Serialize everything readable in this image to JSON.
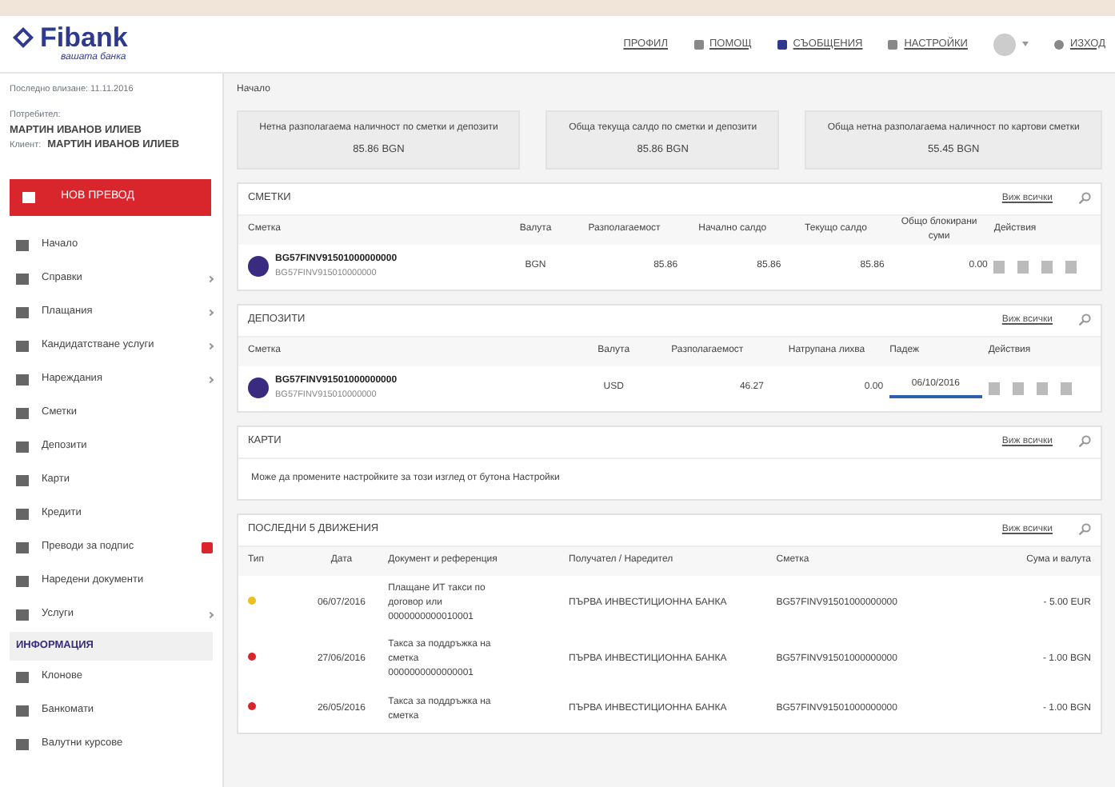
{
  "header": {
    "logo": "Fibank",
    "tagline": "вашата банка",
    "nav": [
      {
        "label": "ПРОФИЛ"
      },
      {
        "label": "ПОМОЩ"
      },
      {
        "label": "СЪОБЩЕНИЯ"
      },
      {
        "label": "НАСТРОЙКИ"
      },
      {
        "label": "ИЗХОД"
      }
    ]
  },
  "user": {
    "last_login": "Последно влизане: 11.11.2016",
    "user_label": "Потребител:",
    "user_name": "МАРТИН ИВАНОВ ИЛИЕВ",
    "client_label": "Клиент:",
    "client_name": "МАРТИН ИВАНОВ ИЛИЕВ"
  },
  "new_transfer": "НОВ ПРЕВОД",
  "sidebar": {
    "items": [
      {
        "label": "Начало",
        "expandable": false,
        "badge": false
      },
      {
        "label": "Справки",
        "expandable": true,
        "badge": false
      },
      {
        "label": "Плащания",
        "expandable": true,
        "badge": false
      },
      {
        "label": "Кандидатстване услуги",
        "expandable": true,
        "badge": false
      },
      {
        "label": "Нареждания",
        "expandable": true,
        "badge": false
      },
      {
        "label": "Сметки",
        "expandable": false,
        "badge": false
      },
      {
        "label": "Депозити",
        "expandable": false,
        "badge": false
      },
      {
        "label": "Карти",
        "expandable": false,
        "badge": false
      },
      {
        "label": "Кредити",
        "expandable": false,
        "badge": false
      },
      {
        "label": "Преводи за подпис",
        "expandable": false,
        "badge": true
      },
      {
        "label": "Наредени документи",
        "expandable": false,
        "badge": false
      },
      {
        "label": "Услуги",
        "expandable": true,
        "badge": false
      }
    ],
    "section": "ИНФОРМАЦИЯ",
    "info_items": [
      {
        "label": "Клонове"
      },
      {
        "label": "Банкомати"
      },
      {
        "label": "Валутни курсове"
      }
    ]
  },
  "breadcrumb": "Начало",
  "summary": [
    {
      "label": "Нетна разполагаема наличност по сметки и депозити",
      "value": "85.86 BGN"
    },
    {
      "label": "Обща текуща салдо по сметки и депозити",
      "value": "85.86 BGN"
    },
    {
      "label": "Обща нетна разполагаема наличност по картови сметки",
      "value": "55.45 BGN"
    }
  ],
  "accounts": {
    "title": "СМЕТКИ",
    "view_all": "Виж всички",
    "columns": [
      "Сметка",
      "Валута",
      "Разполагаемост",
      "Начално салдо",
      "Текущо салдо",
      "Общо блокирани суми",
      "Действия"
    ],
    "rows": [
      {
        "cells": [
          "BG57FINV91501000000000",
          "BGN",
          "85.86",
          "85.86",
          "85.86",
          "0.00"
        ],
        "account_name": "BG57FINV915010000000"
      }
    ]
  },
  "deposits": {
    "title": "ДЕПОЗИТИ",
    "view_all": "Виж всички",
    "columns": [
      "Сметка",
      "Валута",
      "Разполагаемост",
      "Натрупана лихва",
      "Падеж",
      "Действия"
    ],
    "rows": [
      {
        "cells": [
          "BG57FINV91501000000000",
          "USD",
          "46.27",
          "0.00",
          "06/10/2016"
        ],
        "account_name": "BG57FINV915010000000",
        "level": 1
      }
    ]
  },
  "cards": {
    "title": "КАРТИ",
    "view_all": "Виж всички",
    "message": "Може да промените настройките за този изглед от бутона Настройки"
  },
  "movements": {
    "title": "ПОСЛЕДНИ 5 ДВИЖЕНИЯ",
    "view_all": "Виж всички",
    "columns": [
      "Тип",
      "Дата",
      "Документ и референция",
      "Получател / Наредител",
      "Сметка",
      "Сума и валута"
    ],
    "rows": [
      {
        "color": "#e8c020",
        "date": "06/07/2016",
        "doc": [
          "Плащане ИТ такси по",
          "договор или",
          "0000000000010001"
        ],
        "party": "ПЪРВА ИНВЕСТИЦИОННА БАНКА",
        "account": "BG57FINV91501000000000",
        "amount": "- 5.00 EUR"
      },
      {
        "color": "#d9262c",
        "date": "27/06/2016",
        "doc": [
          "Такса за поддръжка на",
          "сметка",
          "0000000000000001"
        ],
        "party": "ПЪРВА ИНВЕСТИЦИОННА БАНКА",
        "account": "BG57FINV91501000000000",
        "amount": "- 1.00 BGN"
      },
      {
        "color": "#d9262c",
        "date": "26/05/2016",
        "doc": [
          "Такса за поддръжка на",
          "сметка"
        ],
        "party": "ПЪРВА ИНВЕСТИЦИОННА БАНКА",
        "account": "BG57FINV91501000000000",
        "amount": "- 1.00 BGN"
      }
    ]
  }
}
